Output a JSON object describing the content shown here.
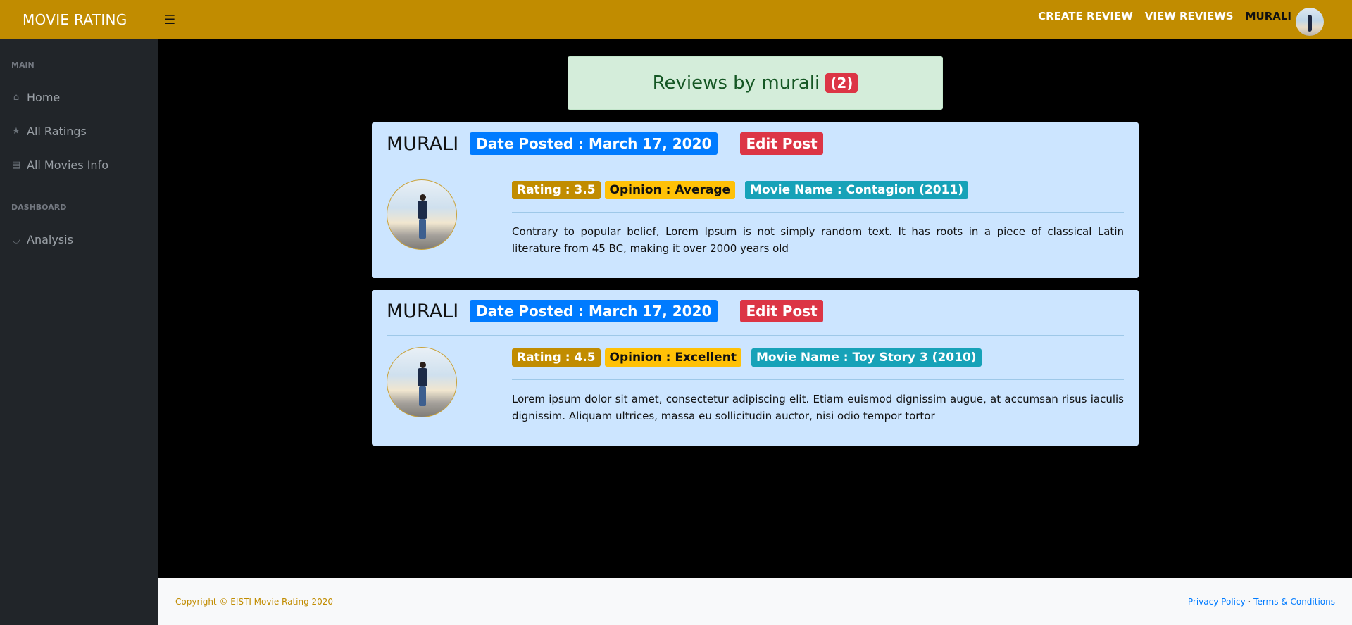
{
  "header": {
    "brand": "MOVIE RATING",
    "menu_icon": "hamburger-icon",
    "nav": [
      {
        "label": "CREATE REVIEW"
      },
      {
        "label": "VIEW REVIEWS"
      }
    ],
    "user": "MURALI"
  },
  "sidebar": {
    "sections": [
      {
        "heading": "MAIN"
      },
      {
        "heading": "DASHBOARD"
      }
    ],
    "items": [
      {
        "label": "Home",
        "icon": "home-icon"
      },
      {
        "label": "All Ratings",
        "icon": "star-icon"
      },
      {
        "label": "All Movies Info",
        "icon": "film-icon"
      },
      {
        "label": "Analysis",
        "icon": "area-chart-icon"
      }
    ]
  },
  "banner": {
    "title": "Reviews by murali",
    "count": "(2)"
  },
  "reviews": [
    {
      "user": "MURALI",
      "date": "Date Posted : March 17, 2020",
      "edit_label": "Edit Post",
      "rating": "Rating : 3.5",
      "opinion": "Opinion : Average",
      "movie": "Movie Name : Contagion (2011)",
      "text": "Contrary to popular belief, Lorem Ipsum is not simply random text. It has roots in a piece of classical Latin literature from 45 BC, making it over 2000 years old"
    },
    {
      "user": "MURALI",
      "date": "Date Posted : March 17, 2020",
      "edit_label": "Edit Post",
      "rating": "Rating : 4.5",
      "opinion": "Opinion : Excellent",
      "movie": "Movie Name : Toy Story 3 (2010)",
      "text": "Lorem ipsum dolor sit amet, consectetur adipiscing elit. Etiam euismod dignissim augue, at accumsan risus iaculis dignissim. Aliquam ultrices, massa eu sollicitudin auctor, nisi odio tempor tortor"
    }
  ],
  "footer": {
    "copyright": "Copyright © EISTI Movie Rating 2020",
    "privacy": "Privacy Policy",
    "separator": "·",
    "terms": "Terms & Conditions"
  },
  "colors": {
    "brand": "#c18c00",
    "sidebar": "#212529",
    "card": "#cce5ff",
    "primary": "#007bff",
    "danger": "#dc3545",
    "warning": "#ffc107",
    "info": "#17a2b8",
    "success_bg": "#d4edda"
  }
}
